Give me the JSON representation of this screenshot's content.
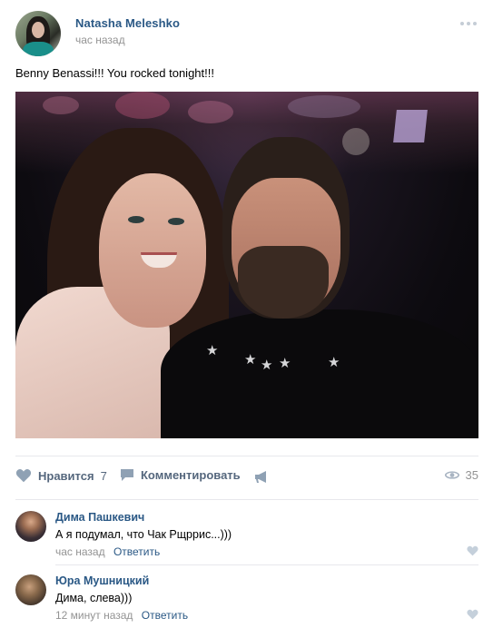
{
  "post": {
    "author": "Natasha Meleshko",
    "time": "час назад",
    "text": "Benny Benassi!!! You rocked tonight!!!",
    "menu_icon": "more-dots-icon"
  },
  "actions": {
    "like_label": "Нравится",
    "like_count": "7",
    "comment_label": "Комментировать",
    "share_icon": "megaphone-icon",
    "views_count": "35",
    "views_icon": "eye-icon"
  },
  "comments": [
    {
      "name": "Дима Пашкевич",
      "text": "А я подумал, что Чак Рщррис...)))",
      "time": "час назад",
      "reply": "Ответить"
    },
    {
      "name": "Юра Мушницкий",
      "text": "Дима, слева)))",
      "time": "12 минут назад",
      "reply": "Ответить"
    }
  ],
  "colors": {
    "link": "#2a5885",
    "action": "#55677d",
    "muted": "#939393",
    "divider": "#e7e8ec",
    "icon": "#c5cdd6"
  }
}
